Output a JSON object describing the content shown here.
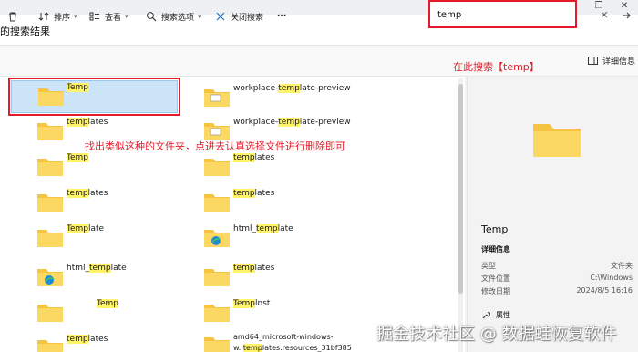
{
  "window": {
    "min": "—",
    "max": "❐",
    "close": "✕"
  },
  "address": {
    "location": "的搜索结果"
  },
  "search": {
    "query": "temp"
  },
  "toolbar": {
    "sort": "排序",
    "view": "查看",
    "search_options": "搜索选项",
    "close_search": "关闭搜索",
    "more": "···",
    "details": "详细信息"
  },
  "annotations": {
    "search_hint": "在此搜索【temp】",
    "find_hint": "找出类似这种的文件夹，点进去认真选择文件进行删除即可"
  },
  "items_left": [
    {
      "pre": "",
      "hl": "Temp",
      "post": ""
    },
    {
      "pre": "",
      "hl": "temp",
      "post": "lates"
    },
    {
      "pre": "",
      "hl": "Temp",
      "post": ""
    },
    {
      "pre": "",
      "hl": "temp",
      "post": "lates"
    },
    {
      "pre": "",
      "hl": "Temp",
      "post": "late"
    },
    {
      "pre": "html_",
      "hl": "temp",
      "post": "late"
    },
    {
      "pre": "",
      "hl": "Temp",
      "post": ""
    },
    {
      "pre": "",
      "hl": "temp",
      "post": "lates"
    }
  ],
  "items_right": [
    {
      "pre": "workplace-",
      "hl": "temp",
      "post": "late-preview"
    },
    {
      "pre": "workplace-",
      "hl": "temp",
      "post": "late-preview"
    },
    {
      "pre": "",
      "hl": "temp",
      "post": "lates"
    },
    {
      "pre": "",
      "hl": "temp",
      "post": "lates"
    },
    {
      "pre": "html_",
      "hl": "temp",
      "post": "late"
    },
    {
      "pre": "",
      "hl": "temp",
      "post": "lates"
    },
    {
      "pre": "",
      "hl": "Temp",
      "post": "lnst"
    },
    {
      "pre": "amd64_microsoft-windows-w..",
      "hl": "temp",
      "post": "lates.resources_31bf385"
    }
  ],
  "preview": {
    "title": "Temp",
    "section": "详细信息",
    "rows": [
      {
        "label": "类型",
        "value": "文件夹"
      },
      {
        "label": "文件位置",
        "value": "C:\\Windows"
      },
      {
        "label": "修改日期",
        "value": "2024/8/5 16:16"
      }
    ],
    "attributes": "属性"
  },
  "watermark": "掘金技术社区 @ 数据蛙恢复软件",
  "colors": {
    "highlight": "#fff36a",
    "annotation": "#e41c2a",
    "selection": "#cce4f7",
    "folder": "#f5c542"
  }
}
